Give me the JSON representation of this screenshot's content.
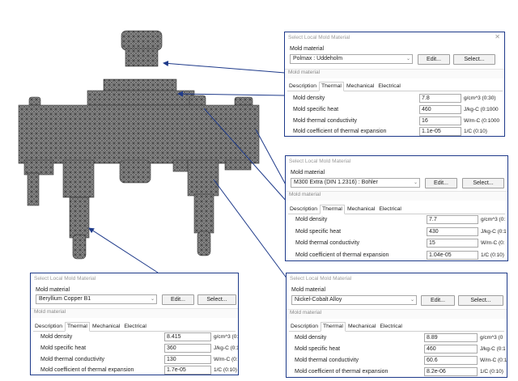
{
  "dialogs": [
    {
      "id": "top",
      "title": "Select Local Mold Material",
      "mold_material_label": "Mold material",
      "material": "Polmax : Uddeholm",
      "edit_label": "Edit...",
      "select_label": "Select...",
      "section_label": "Mold material",
      "tabs": [
        "Description",
        "Thermal",
        "Mechanical",
        "Electrical"
      ],
      "active_tab": "Thermal",
      "properties": [
        {
          "name": "Mold density",
          "value": "7.8",
          "unit": "g/cm^3 (0:30)"
        },
        {
          "name": "Mold specific heat",
          "value": "460",
          "unit": "J/kg-C (0:1000"
        },
        {
          "name": "Mold thermal conductivity",
          "value": "16",
          "unit": "W/m-C (0:1000"
        },
        {
          "name": "Mold coefficient of thermal expansion",
          "value": "1.1e-05",
          "unit": "1/C (0:10)"
        }
      ]
    },
    {
      "id": "middle",
      "title": "Select Local Mold Material",
      "mold_material_label": "Mold material",
      "material": "M300 Extra (DIN 1.2316) : Bohler",
      "edit_label": "Edit...",
      "select_label": "Select...",
      "section_label": "Mold material",
      "tabs": [
        "Description",
        "Thermal",
        "Mechanical",
        "Electrical"
      ],
      "active_tab": "Thermal",
      "properties": [
        {
          "name": "Mold density",
          "value": "7.7",
          "unit": "g/cm^3 (0:"
        },
        {
          "name": "Mold specific heat",
          "value": "430",
          "unit": "J/kg-C (0:1"
        },
        {
          "name": "Mold thermal conductivity",
          "value": "15",
          "unit": "W/m-C (0:"
        },
        {
          "name": "Mold coefficient of thermal expansion",
          "value": "1.04e-05",
          "unit": "1/C (0:10)"
        }
      ]
    },
    {
      "id": "bottom-left",
      "title": "Select Local Mold Material",
      "mold_material_label": "Mold material",
      "material": "Beryllium Copper B1",
      "edit_label": "Edit...",
      "select_label": "Select...",
      "section_label": "Mold material",
      "tabs": [
        "Description",
        "Thermal",
        "Mechanical",
        "Electrical"
      ],
      "active_tab": "Thermal",
      "properties": [
        {
          "name": "Mold density",
          "value": "8.415",
          "unit": "g/cm^3 (0:"
        },
        {
          "name": "Mold specific heat",
          "value": "360",
          "unit": "J/kg-C (0:1"
        },
        {
          "name": "Mold thermal conductivity",
          "value": "130",
          "unit": "W/m-C (0:"
        },
        {
          "name": "Mold coefficient of thermal expansion",
          "value": "1.7e-05",
          "unit": "1/C (0:10)"
        }
      ]
    },
    {
      "id": "bottom-right",
      "title": "Select Local Mold Material",
      "mold_material_label": "Mold material",
      "material": "Nickel-Cobalt Alloy",
      "edit_label": "Edit...",
      "select_label": "Select...",
      "section_label": "Mold material",
      "tabs": [
        "Description",
        "Thermal",
        "Mechanical",
        "Electrical"
      ],
      "active_tab": "Thermal",
      "properties": [
        {
          "name": "Mold density",
          "value": "8.89",
          "unit": "g/cm^3 (0"
        },
        {
          "name": "Mold specific heat",
          "value": "460",
          "unit": "J/kg-C (0:1"
        },
        {
          "name": "Mold thermal conductivity",
          "value": "60.6",
          "unit": "W/m-C (0:1"
        },
        {
          "name": "Mold coefficient of thermal expansion",
          "value": "8.2e-06",
          "unit": "1/C (0:10)"
        }
      ]
    }
  ],
  "colors": {
    "mesh_fill": "#8c8c8c",
    "mesh_line": "#2e2e2e",
    "dialog_border": "#1e3a8a",
    "arrow": "#1e3a8a"
  }
}
